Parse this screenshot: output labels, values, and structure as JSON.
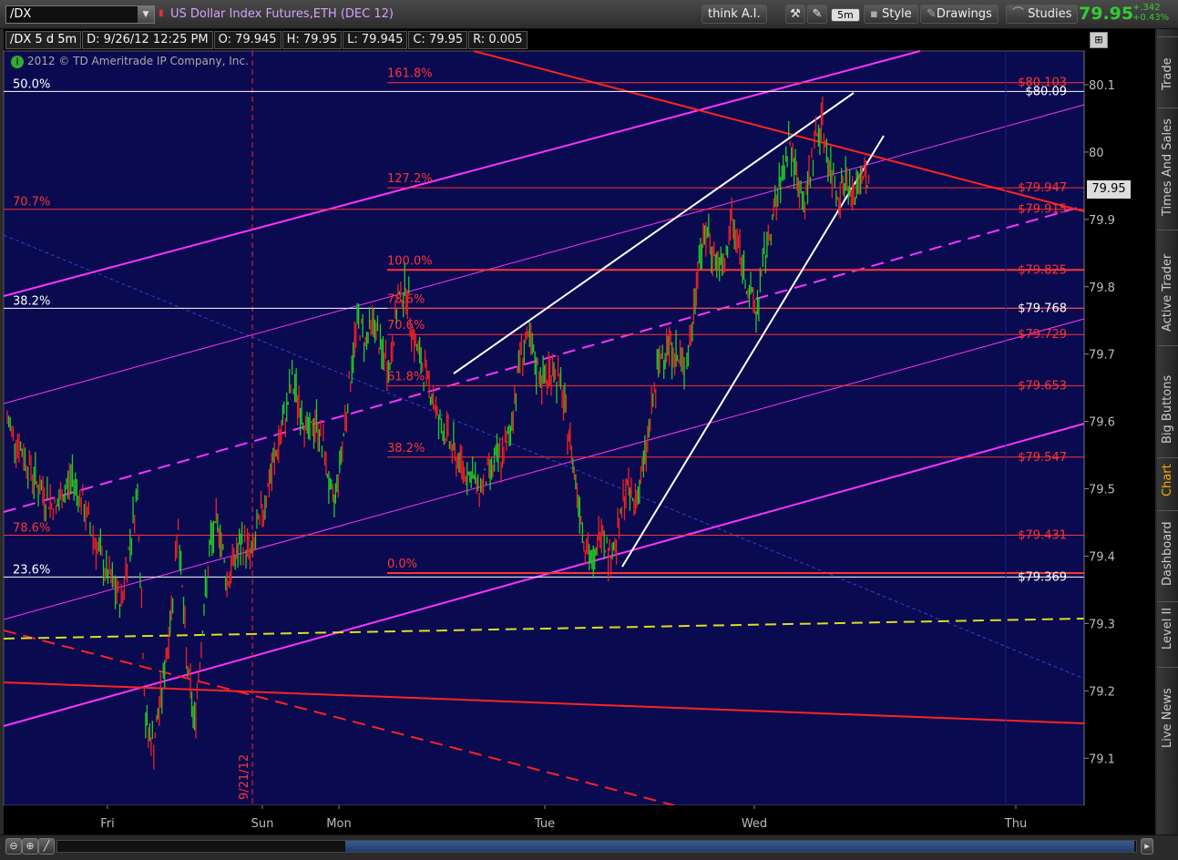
{
  "header": {
    "symbol": "/DX",
    "description": "US Dollar Index Futures,ETH (DEC 12)",
    "think_ai": "think A.I.",
    "aggregation": "5m",
    "style_label": "Style",
    "drawings_label": "Drawings",
    "studies_label": "Studies",
    "last_price": "79.95",
    "net_change": "+.342",
    "pct_change": "+0.43%"
  },
  "info_bar": {
    "symbol_period": "/DX 5 d 5m",
    "date": "D: 9/26/12 12:25 PM",
    "open": "O: 79.945",
    "high": "H: 79.95",
    "low": "L: 79.945",
    "close": "C: 79.95",
    "range": "R: 0.005"
  },
  "copyright": "2012 © TD Ameritrade IP Company, Inc.",
  "chart_data": {
    "type": "candlestick",
    "y_range": [
      79.03,
      80.15
    ],
    "y_ticks": [
      "80.1",
      "80",
      "79.9",
      "79.8",
      "79.7",
      "79.6",
      "79.5",
      "79.4",
      "79.3",
      "79.2",
      "79.1"
    ],
    "x_labels": [
      "Fri",
      "Sun",
      "Mon",
      "Tue",
      "Wed",
      "Thu"
    ],
    "session_marker_label": "9/21/12",
    "last_price_tag": "79.95",
    "right_fib_labels": [
      {
        "text": "$80.103",
        "value": 80.103,
        "color": "#ff3333"
      },
      {
        "text": "$80.09",
        "value": 80.09,
        "color": "#ffffff"
      },
      {
        "text": "$79.947",
        "value": 79.947,
        "color": "#ff3333"
      },
      {
        "text": "$79.915",
        "value": 79.915,
        "color": "#ff3333"
      },
      {
        "text": "$79.825",
        "value": 79.825,
        "color": "#ff3333"
      },
      {
        "text": "$79.768",
        "value": 79.768,
        "color": "#ffffff"
      },
      {
        "text": "$79.729",
        "value": 79.729,
        "color": "#ff3333"
      },
      {
        "text": "$79.653",
        "value": 79.653,
        "color": "#ff3333"
      },
      {
        "text": "$79.547",
        "value": 79.547,
        "color": "#ff3333"
      },
      {
        "text": "$79.431",
        "value": 79.431,
        "color": "#ff3333"
      },
      {
        "text": "$79.369",
        "value": 79.369,
        "color": "#ffffff"
      }
    ],
    "left_fib_labels": [
      {
        "text": "50.0%",
        "value": 80.09,
        "color": "#ffffff"
      },
      {
        "text": "70.7%",
        "value": 79.915,
        "color": "#ff3333"
      },
      {
        "text": "38.2%",
        "value": 79.768,
        "color": "#ffffff"
      },
      {
        "text": "78.6%",
        "value": 79.431,
        "color": "#ff3333"
      },
      {
        "text": "23.6%",
        "value": 79.369,
        "color": "#ffffff"
      }
    ],
    "mid_fib_labels": [
      {
        "text": "161.8%",
        "value": 80.103
      },
      {
        "text": "127.2%",
        "value": 79.947
      },
      {
        "text": "100.0%",
        "value": 79.825
      },
      {
        "text": "78.6%",
        "value": 79.768
      },
      {
        "text": "70.6%",
        "value": 79.729
      },
      {
        "text": "61.8%",
        "value": 79.653
      },
      {
        "text": "38.2%",
        "value": 79.547
      },
      {
        "text": "0.0%",
        "value": 79.375
      }
    ],
    "price_path": [
      [
        0,
        79.6
      ],
      [
        4,
        79.55
      ],
      [
        8,
        79.5
      ],
      [
        12,
        79.47
      ],
      [
        16,
        79.52
      ],
      [
        20,
        79.45
      ],
      [
        24,
        79.38
      ],
      [
        28,
        79.33
      ],
      [
        32,
        79.5
      ],
      [
        34,
        79.15
      ],
      [
        36,
        79.12
      ],
      [
        38,
        79.2
      ],
      [
        40,
        79.3
      ],
      [
        42,
        79.45
      ],
      [
        44,
        79.25
      ],
      [
        46,
        79.15
      ],
      [
        48,
        79.3
      ],
      [
        50,
        79.42
      ],
      [
        52,
        79.45
      ],
      [
        54,
        79.36
      ],
      [
        56,
        79.4
      ],
      [
        58,
        79.42
      ],
      [
        60,
        79.4
      ],
      [
        62,
        79.45
      ],
      [
        64,
        79.5
      ],
      [
        66,
        79.55
      ],
      [
        68,
        79.6
      ],
      [
        70,
        79.66
      ],
      [
        72,
        79.62
      ],
      [
        74,
        79.58
      ],
      [
        76,
        79.6
      ],
      [
        78,
        79.55
      ],
      [
        80,
        79.47
      ],
      [
        82,
        79.55
      ],
      [
        84,
        79.65
      ],
      [
        86,
        79.75
      ],
      [
        88,
        79.72
      ],
      [
        90,
        79.75
      ],
      [
        92,
        79.7
      ],
      [
        94,
        79.68
      ],
      [
        96,
        79.78
      ],
      [
        98,
        79.8
      ],
      [
        100,
        79.72
      ],
      [
        102,
        79.68
      ],
      [
        104,
        79.65
      ],
      [
        106,
        79.6
      ],
      [
        108,
        79.58
      ],
      [
        110,
        79.55
      ],
      [
        112,
        79.53
      ],
      [
        114,
        79.52
      ],
      [
        116,
        79.5
      ],
      [
        118,
        79.52
      ],
      [
        120,
        79.54
      ],
      [
        122,
        79.55
      ],
      [
        124,
        79.6
      ],
      [
        126,
        79.7
      ],
      [
        128,
        79.72
      ],
      [
        130,
        79.68
      ],
      [
        132,
        79.66
      ],
      [
        134,
        79.68
      ],
      [
        136,
        79.65
      ],
      [
        138,
        79.58
      ],
      [
        140,
        79.5
      ],
      [
        142,
        79.42
      ],
      [
        144,
        79.38
      ],
      [
        146,
        79.45
      ],
      [
        148,
        79.4
      ],
      [
        150,
        79.43
      ],
      [
        152,
        79.5
      ],
      [
        154,
        79.48
      ],
      [
        156,
        79.52
      ],
      [
        158,
        79.6
      ],
      [
        160,
        79.68
      ],
      [
        162,
        79.72
      ],
      [
        164,
        79.7
      ],
      [
        166,
        79.68
      ],
      [
        168,
        79.72
      ],
      [
        170,
        79.85
      ],
      [
        172,
        79.88
      ],
      [
        174,
        79.84
      ],
      [
        176,
        79.82
      ],
      [
        178,
        79.9
      ],
      [
        180,
        79.85
      ],
      [
        182,
        79.8
      ],
      [
        184,
        79.76
      ],
      [
        186,
        79.84
      ],
      [
        188,
        79.9
      ],
      [
        190,
        79.95
      ],
      [
        192,
        80.02
      ],
      [
        194,
        79.96
      ],
      [
        196,
        79.92
      ],
      [
        198,
        80.0
      ],
      [
        200,
        80.05
      ],
      [
        202,
        79.98
      ],
      [
        204,
        79.94
      ],
      [
        206,
        79.96
      ],
      [
        208,
        79.93
      ],
      [
        210,
        79.97
      ],
      [
        212,
        79.95
      ]
    ]
  },
  "side_tabs": [
    "Trade",
    "Times And Sales",
    "Active Trader",
    "Big Buttons",
    "Chart",
    "Dashboard",
    "Level II",
    "Live News"
  ],
  "colors": {
    "chart_bg": "#0a0a50",
    "up_bar": "#22cc22",
    "down_bar": "#ee2222",
    "fib": "#ff3333",
    "channel": "#ff33ff",
    "trendline": "#ffffff",
    "support": "#dddd22"
  }
}
